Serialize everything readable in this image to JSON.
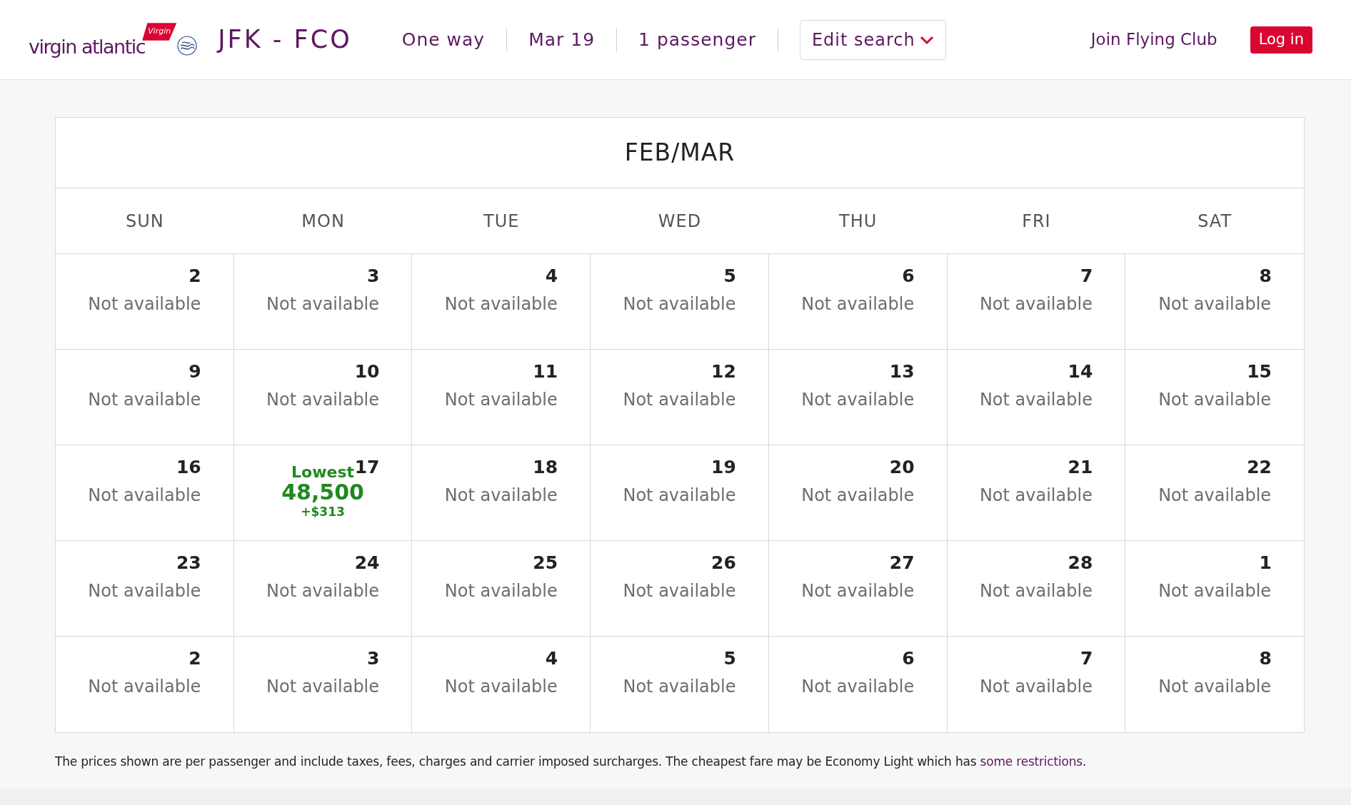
{
  "header": {
    "logo": {
      "wordmark": "virgin atlantic",
      "tail": "Virgin"
    },
    "route": "JFK - FCO",
    "trip": [
      "One way",
      "Mar 19",
      "1 passenger"
    ],
    "edit_search": "Edit search",
    "join": "Join Flying Club",
    "login": "Log in"
  },
  "calendar": {
    "title": "FEB/MAR",
    "weekdays": [
      "SUN",
      "MON",
      "TUE",
      "WED",
      "THU",
      "FRI",
      "SAT"
    ],
    "weeks": [
      [
        {
          "day": "2",
          "kind": "unavailable",
          "status": "Not available"
        },
        {
          "day": "3",
          "kind": "unavailable",
          "status": "Not available"
        },
        {
          "day": "4",
          "kind": "unavailable",
          "status": "Not available"
        },
        {
          "day": "5",
          "kind": "unavailable",
          "status": "Not available"
        },
        {
          "day": "6",
          "kind": "unavailable",
          "status": "Not available"
        },
        {
          "day": "7",
          "kind": "unavailable",
          "status": "Not available"
        },
        {
          "day": "8",
          "kind": "unavailable",
          "status": "Not available"
        }
      ],
      [
        {
          "day": "9",
          "kind": "unavailable",
          "status": "Not available"
        },
        {
          "day": "10",
          "kind": "unavailable",
          "status": "Not available"
        },
        {
          "day": "11",
          "kind": "unavailable",
          "status": "Not available"
        },
        {
          "day": "12",
          "kind": "unavailable",
          "status": "Not available"
        },
        {
          "day": "13",
          "kind": "unavailable",
          "status": "Not available"
        },
        {
          "day": "14",
          "kind": "unavailable",
          "status": "Not available"
        },
        {
          "day": "15",
          "kind": "unavailable",
          "status": "Not available"
        }
      ],
      [
        {
          "day": "16",
          "kind": "unavailable",
          "status": "Not available"
        },
        {
          "day": "17",
          "kind": "lowest",
          "label": "Lowest",
          "miles": "48,500",
          "surcharge": "+$313"
        },
        {
          "day": "18",
          "kind": "unavailable",
          "status": "Not available"
        },
        {
          "day": "19",
          "kind": "unavailable",
          "status": "Not available"
        },
        {
          "day": "20",
          "kind": "unavailable",
          "status": "Not available"
        },
        {
          "day": "21",
          "kind": "unavailable",
          "status": "Not available"
        },
        {
          "day": "22",
          "kind": "unavailable",
          "status": "Not available"
        }
      ],
      [
        {
          "day": "23",
          "kind": "unavailable",
          "status": "Not available"
        },
        {
          "day": "24",
          "kind": "unavailable",
          "status": "Not available"
        },
        {
          "day": "25",
          "kind": "unavailable",
          "status": "Not available"
        },
        {
          "day": "26",
          "kind": "unavailable",
          "status": "Not available"
        },
        {
          "day": "27",
          "kind": "unavailable",
          "status": "Not available"
        },
        {
          "day": "28",
          "kind": "unavailable",
          "status": "Not available"
        },
        {
          "day": "1",
          "kind": "unavailable",
          "status": "Not available"
        }
      ],
      [
        {
          "day": "2",
          "kind": "unavailable",
          "status": "Not available"
        },
        {
          "day": "3",
          "kind": "unavailable",
          "status": "Not available"
        },
        {
          "day": "4",
          "kind": "unavailable",
          "status": "Not available"
        },
        {
          "day": "5",
          "kind": "unavailable",
          "status": "Not available"
        },
        {
          "day": "6",
          "kind": "unavailable",
          "status": "Not available"
        },
        {
          "day": "7",
          "kind": "unavailable",
          "status": "Not available"
        },
        {
          "day": "8",
          "kind": "unavailable",
          "status": "Not available"
        }
      ]
    ]
  },
  "footnote": {
    "text": "The prices shown are per passenger and include taxes, fees, charges and carrier imposed surcharges. The cheapest fare may be Economy Light which has",
    "link": "some restrictions",
    "end": "."
  }
}
